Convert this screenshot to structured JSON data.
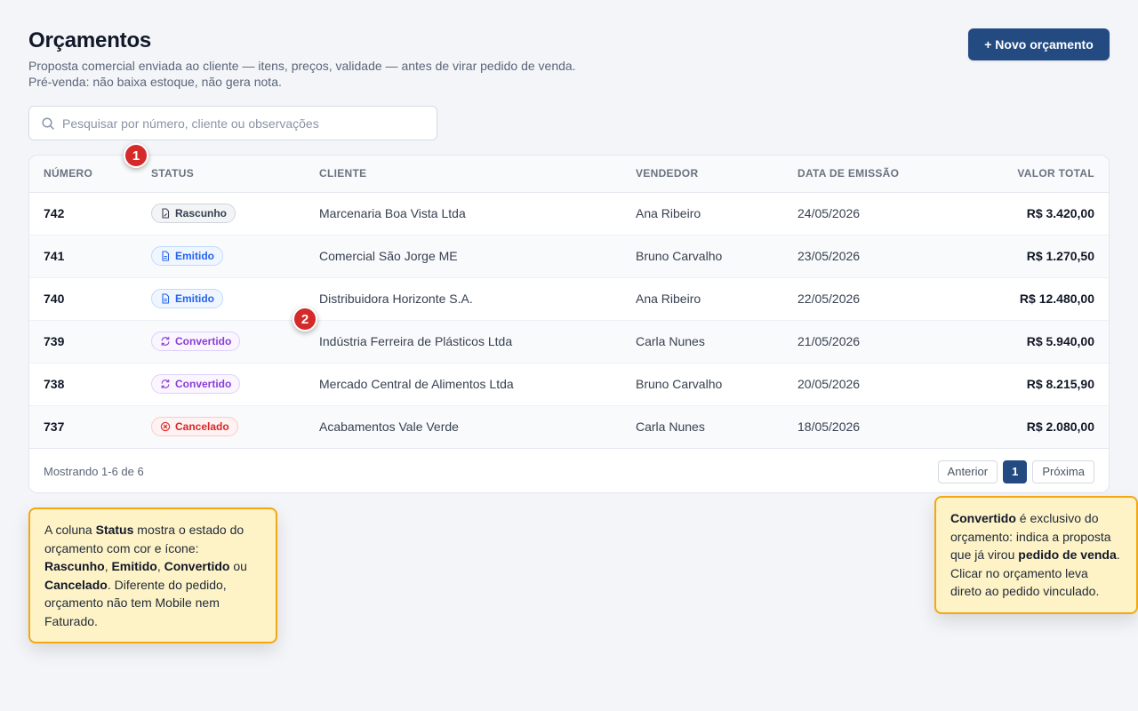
{
  "header": {
    "title": "Orçamentos",
    "subtitle": "Proposta comercial enviada ao cliente — itens, preços, validade — antes de virar pedido de venda. Pré-venda: não baixa estoque, não gera nota.",
    "new_button_label": "+ Novo orçamento"
  },
  "search": {
    "placeholder": "Pesquisar por número, cliente ou observações",
    "icon": "search-icon"
  },
  "table": {
    "columns": {
      "number": "NÚMERO",
      "status": "STATUS",
      "client": "CLIENTE",
      "seller": "VENDEDOR",
      "date": "DATA DE EMISSÃO",
      "total": "VALOR TOTAL"
    },
    "rows": [
      {
        "number": "742",
        "status": "Rascunho",
        "client": "Marcenaria Boa Vista Ltda",
        "seller": "Ana Ribeiro",
        "date": "24/05/2026",
        "total": "R$ 3.420,00"
      },
      {
        "number": "741",
        "status": "Emitido",
        "client": "Comercial São Jorge ME",
        "seller": "Bruno Carvalho",
        "date": "23/05/2026",
        "total": "R$ 1.270,50"
      },
      {
        "number": "740",
        "status": "Emitido",
        "client": "Distribuidora Horizonte S.A.",
        "seller": "Ana Ribeiro",
        "date": "22/05/2026",
        "total": "R$ 12.480,00"
      },
      {
        "number": "739",
        "status": "Convertido",
        "client": "Indústria Ferreira de Plásticos Ltda",
        "seller": "Carla Nunes",
        "date": "21/05/2026",
        "total": "R$ 5.940,00"
      },
      {
        "number": "738",
        "status": "Convertido",
        "client": "Mercado Central de Alimentos Ltda",
        "seller": "Bruno Carvalho",
        "date": "20/05/2026",
        "total": "R$ 8.215,90"
      },
      {
        "number": "737",
        "status": "Cancelado",
        "client": "Acabamentos Vale Verde",
        "seller": "Carla Nunes",
        "date": "18/05/2026",
        "total": "R$ 2.080,00"
      }
    ],
    "footer": {
      "showing": "Mostrando 1-6 de 6",
      "prev_label": "Anterior",
      "current_page": "1",
      "next_label": "Próxima"
    }
  },
  "status_styles": {
    "Rascunho": {
      "class": "rascunho",
      "icon": "draft-document-icon"
    },
    "Emitido": {
      "class": "emitido",
      "icon": "document-icon"
    },
    "Convertido": {
      "class": "convertido",
      "icon": "refresh-icon"
    },
    "Cancelado": {
      "class": "cancelado",
      "icon": "x-circle-icon"
    }
  },
  "annotations": {
    "marker_1": "1",
    "marker_2": "2",
    "note_status": [
      {
        "t": "A coluna "
      },
      {
        "b": "Status"
      },
      {
        "t": " mostra o estado do orçamento com cor e ícone: "
      },
      {
        "b": "Rascunho"
      },
      {
        "t": ", "
      },
      {
        "b": "Emitido"
      },
      {
        "t": ", "
      },
      {
        "b": "Convertido"
      },
      {
        "t": " ou "
      },
      {
        "b": "Cancelado"
      },
      {
        "t": ". Diferente do pedido, orçamento não tem Mobile nem Faturado."
      }
    ],
    "note_convertido": [
      {
        "b": "Convertido"
      },
      {
        "t": " é exclusivo do orçamento: indica a proposta que já virou "
      },
      {
        "b": "pedido de venda"
      },
      {
        "t": ". Clicar no orçamento leva direto ao pedido vinculado."
      }
    ]
  },
  "colors": {
    "primary": "#234b82",
    "marker": "#d42a2a",
    "note_bg": "#fef3c7",
    "note_border": "#f3a712"
  }
}
